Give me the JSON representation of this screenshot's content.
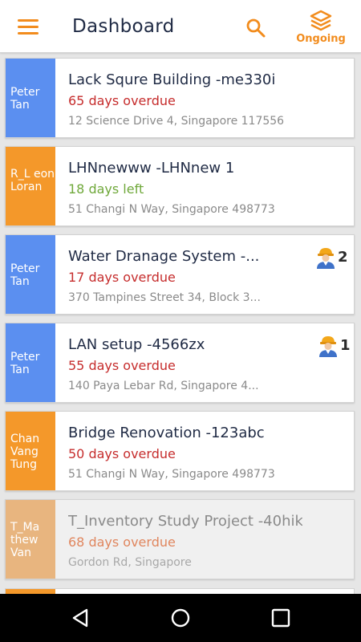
{
  "header": {
    "title": "Dashboard",
    "ongoing_label": "Ongoing",
    "accent_color": "#f28c1d"
  },
  "projects": [
    {
      "initials": "Peter Tan",
      "title": "Lack Squre Building -me330i",
      "status": "65 days overdue",
      "status_type": "overdue",
      "address": "12 Science Drive 4, Singapore 117556"
    },
    {
      "initials": "R_L eon Loran",
      "title": "LHNnewww -LHNnew 1",
      "status": "18 days left",
      "status_type": "left",
      "address": "51 Changi N Way, Singapore 498773"
    },
    {
      "initials": "Peter Tan",
      "title": "Water Dranage System -...",
      "status": "17 days overdue",
      "status_type": "overdue",
      "address": "370 Tampines Street 34, Block 3...",
      "workers": "2"
    },
    {
      "initials": "Peter Tan",
      "title": "LAN setup -4566zx",
      "status": "55 days overdue",
      "status_type": "overdue",
      "address": "140 Paya Lebar Rd, Singapore 4...",
      "workers": "1"
    },
    {
      "initials": "Chan Vang Tung",
      "title": "Bridge Renovation -123abc",
      "status": "50 days overdue",
      "status_type": "overdue",
      "address": "51 Changi N Way, Singapore 498773"
    },
    {
      "initials": "T_Ma thew Van",
      "title": "T_Inventory Study Project -40hik",
      "status": "68 days overdue",
      "status_type": "overdue",
      "address": "Gordon Rd, Singapore"
    }
  ],
  "icons": {
    "menu": "menu-icon",
    "search": "search-icon",
    "ongoing": "layers-icon",
    "worker": "worker-icon",
    "back": "back-icon",
    "home": "home-icon",
    "recents": "recents-icon"
  },
  "colors": {
    "overdue": "#c62d2d",
    "days_left": "#6fa83a",
    "avatar_blue": "#5b8ff0",
    "avatar_orange": "#f4982a"
  }
}
